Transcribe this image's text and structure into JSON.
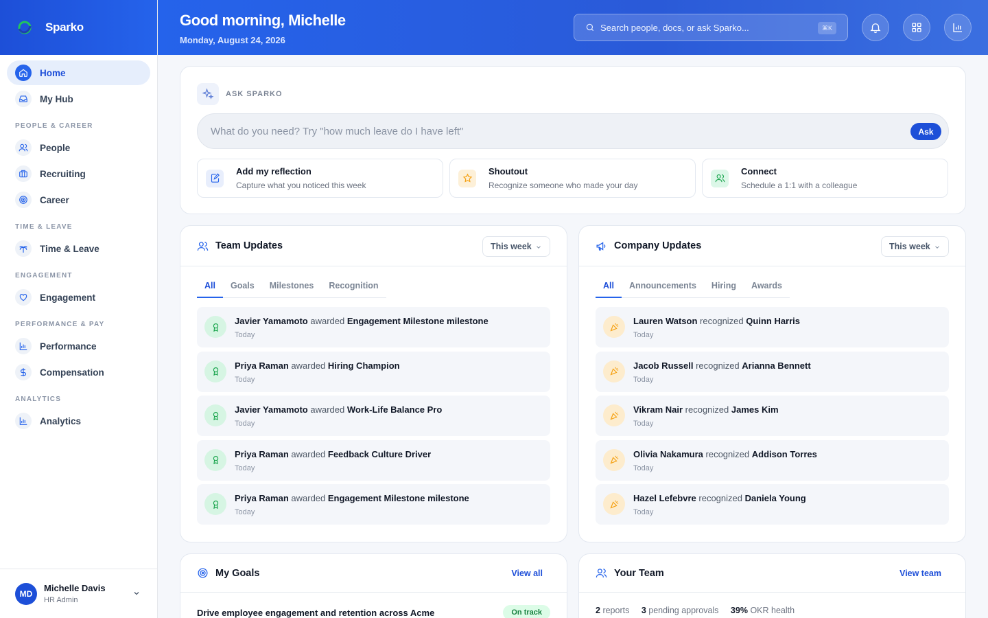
{
  "brand": {
    "name": "Sparko"
  },
  "sidebar": {
    "home": "Home",
    "hub": "My Hub",
    "sections": [
      "PEOPLE & CAREER",
      "TIME & LEAVE",
      "ENGAGEMENT",
      "PERFORMANCE & PAY",
      "ANALYTICS"
    ],
    "people": "People",
    "recruiting": "Recruiting",
    "career": "Career",
    "time_leave": "Time & Leave",
    "engagement": "Engagement",
    "performance": "Performance",
    "compensation": "Compensation",
    "analytics": "Analytics"
  },
  "user": {
    "initials": "MD",
    "name": "Michelle Davis",
    "role": "HR Admin"
  },
  "header": {
    "greeting": "Good morning, Michelle",
    "date": "Monday, August 24, 2026",
    "search_placeholder": "Search people, docs, or ask Sparko...",
    "shortcut": "⌘K"
  },
  "ask": {
    "title": "ASK SPARKO",
    "placeholder": "What do you need? Try \"how much leave do I have left\"",
    "button": "Ask",
    "quick": [
      {
        "title": "Add my reflection",
        "sub": "Capture what you noticed this week"
      },
      {
        "title": "Shoutout",
        "sub": "Recognize someone who made your day"
      },
      {
        "title": "Connect",
        "sub": "Schedule a 1:1 with a colleague"
      }
    ]
  },
  "team_updates": {
    "title": "Team Updates",
    "range": "This week",
    "tabs": [
      "All",
      "Goals",
      "Milestones",
      "Recognition"
    ],
    "items": [
      {
        "actor": "Javier Yamamoto",
        "verb": "awarded",
        "target": "Engagement Milestone milestone",
        "time": "Today"
      },
      {
        "actor": "Priya Raman",
        "verb": "awarded",
        "target": "Hiring Champion",
        "time": "Today"
      },
      {
        "actor": "Javier Yamamoto",
        "verb": "awarded",
        "target": "Work-Life Balance Pro",
        "time": "Today"
      },
      {
        "actor": "Priya Raman",
        "verb": "awarded",
        "target": "Feedback Culture Driver",
        "time": "Today"
      },
      {
        "actor": "Priya Raman",
        "verb": "awarded",
        "target": "Engagement Milestone milestone",
        "time": "Today"
      }
    ]
  },
  "company_updates": {
    "title": "Company Updates",
    "range": "This week",
    "tabs": [
      "All",
      "Announcements",
      "Hiring",
      "Awards"
    ],
    "items": [
      {
        "actor": "Lauren Watson",
        "verb": "recognized",
        "target": "Quinn Harris",
        "time": "Today"
      },
      {
        "actor": "Jacob Russell",
        "verb": "recognized",
        "target": "Arianna Bennett",
        "time": "Today"
      },
      {
        "actor": "Vikram Nair",
        "verb": "recognized",
        "target": "James Kim",
        "time": "Today"
      },
      {
        "actor": "Olivia Nakamura",
        "verb": "recognized",
        "target": "Addison Torres",
        "time": "Today"
      },
      {
        "actor": "Hazel Lefebvre",
        "verb": "recognized",
        "target": "Daniela Young",
        "time": "Today"
      }
    ]
  },
  "goals": {
    "title": "My Goals",
    "link": "View all",
    "first_goal": "Drive employee engagement and retention across Acme",
    "first_status": "On track"
  },
  "team": {
    "title": "Your Team",
    "link": "View team",
    "reports_count": "2",
    "reports_label": "reports",
    "approvals_count": "3",
    "approvals_label": "pending approvals",
    "okr_value": "39%",
    "okr_label": "OKR health"
  },
  "colors": {
    "primary": "#2563eb",
    "success": "#15803d",
    "warning": "#f59e0b"
  }
}
